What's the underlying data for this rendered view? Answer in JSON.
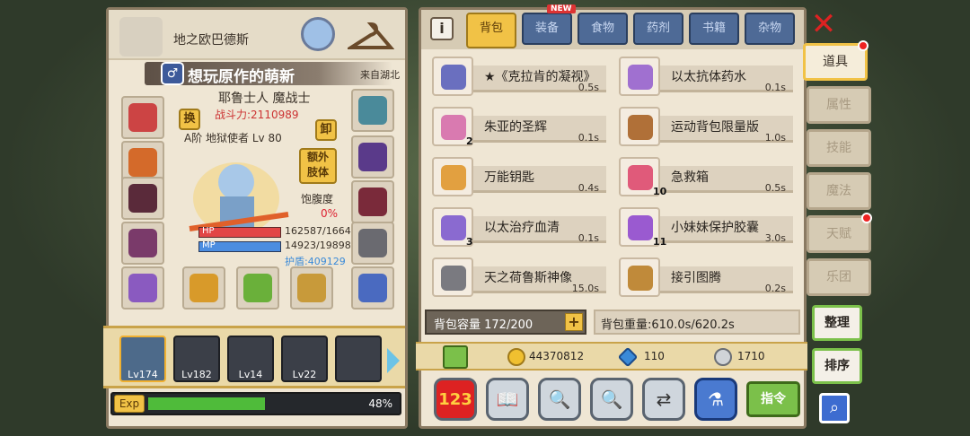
{
  "character": {
    "map": "地之欧巴德斯",
    "player_name": "想玩原作的萌新",
    "origin": "来自湖北",
    "gender_icon": "♂",
    "race_class": "耶鲁士人 魔战士",
    "power": "战斗力:2110989",
    "guild": "A阶 地狱使者 Lv 80",
    "swap_label": "换",
    "unequip_label": "卸",
    "extra_body_label": "额外\n肢体",
    "satiety_label": "饱腹度",
    "satiety_value": "0%",
    "hp_label": "HP",
    "mp_label": "MP",
    "hp_value": "162587/1664",
    "mp_value": "14923/19898",
    "shield": "护盾:409129",
    "exp_label": "Exp",
    "exp_percent": "48%",
    "exp_fraction": 0.48
  },
  "team": [
    {
      "level": "Lv174",
      "selected": true
    },
    {
      "level": "Lv182",
      "selected": false
    },
    {
      "level": "Lv14",
      "selected": false
    },
    {
      "level": "Lv22",
      "selected": false
    },
    {
      "level": "",
      "selected": false
    }
  ],
  "tabs": [
    {
      "label": "背包",
      "active": true
    },
    {
      "label": "装备",
      "active": false
    },
    {
      "label": "食物",
      "active": false
    },
    {
      "label": "药剂",
      "active": false
    },
    {
      "label": "书籍",
      "active": false
    },
    {
      "label": "杂物",
      "active": false
    }
  ],
  "new_badge": "NEW",
  "items": [
    {
      "name": "★《克拉肯的凝视》",
      "weight": "0.5s",
      "qty": "",
      "color": "#6a6fbf"
    },
    {
      "name": "以太抗体药水",
      "weight": "0.1s",
      "qty": "",
      "color": "#a070d0"
    },
    {
      "name": "朱亚的圣辉",
      "weight": "0.1s",
      "qty": "2",
      "color": "#d97ab0"
    },
    {
      "name": "运动背包限量版",
      "weight": "1.0s",
      "qty": "",
      "color": "#b07038"
    },
    {
      "name": "万能钥匙",
      "weight": "0.4s",
      "qty": "",
      "color": "#e2a040"
    },
    {
      "name": "急救箱",
      "weight": "0.5s",
      "qty": "10",
      "color": "#e05a7a"
    },
    {
      "name": "以太治疗血清",
      "weight": "0.1s",
      "qty": "3",
      "color": "#8a6ad0"
    },
    {
      "name": "小妹妹保护胶囊",
      "weight": "3.0s",
      "qty": "11",
      "color": "#9a5ad0"
    },
    {
      "name": "天之荷鲁斯神像",
      "weight": "15.0s",
      "qty": "",
      "color": "#7a7a80"
    },
    {
      "name": "接引图腾",
      "weight": "0.2s",
      "qty": "",
      "color": "#c08a3a"
    }
  ],
  "capacity": "背包容量 172/200",
  "bag_weight": "背包重量:610.0s/620.2s",
  "gold": "44370812",
  "diamonds": "110",
  "silver": "1710",
  "command_label": "指令",
  "side_tabs": [
    {
      "label": "道具",
      "active": true,
      "dot": true
    },
    {
      "label": "属性",
      "active": false,
      "dot": false
    },
    {
      "label": "技能",
      "active": false,
      "dot": false
    },
    {
      "label": "魔法",
      "active": false,
      "dot": false
    },
    {
      "label": "天赋",
      "active": false,
      "dot": true
    },
    {
      "label": "乐团",
      "active": false,
      "dot": false
    }
  ],
  "tidy_label": "整理",
  "sort_label": "排序",
  "close_icon": "✕",
  "search_icon": "search-icon"
}
